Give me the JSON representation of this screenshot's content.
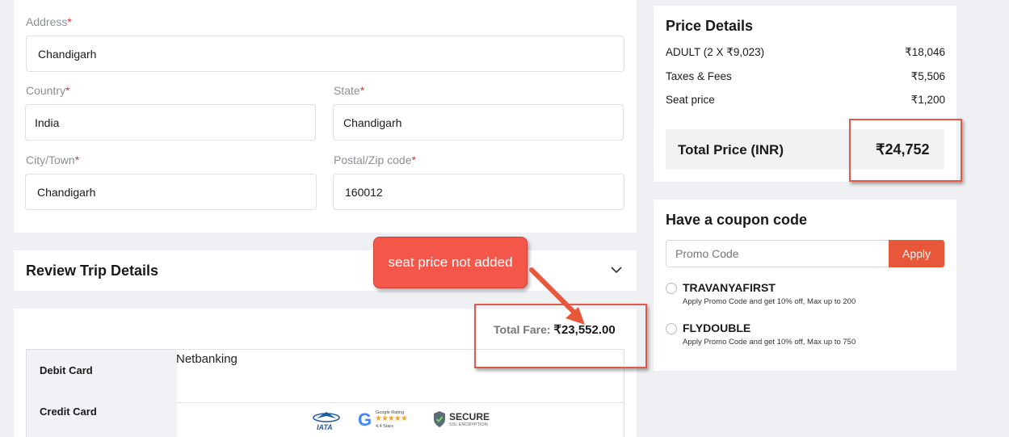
{
  "address_form": {
    "address": {
      "label": "Address",
      "value": "Chandigarh"
    },
    "country": {
      "label": "Country",
      "value": "India"
    },
    "state": {
      "label": "State",
      "value": "Chandigarh"
    },
    "city": {
      "label": "City/Town",
      "value": "Chandigarh"
    },
    "postal": {
      "label": "Postal/Zip code",
      "value": "160012"
    },
    "required_mark": "*"
  },
  "review": {
    "title": "Review Trip Details"
  },
  "annotation": {
    "text": "seat price not added"
  },
  "payment": {
    "total_fare_label": "Total Fare:",
    "total_fare_value": "₹23,552.00",
    "methods": [
      "Debit Card",
      "Credit Card"
    ],
    "selected_tab": "Netbanking",
    "badges": {
      "iata": "IATA",
      "google_rating": "Google Rating",
      "google_stars": "4.4 Stars",
      "secure": "SECURE",
      "secure_sub": "SSL ENCRYPTION"
    }
  },
  "price_details": {
    "title": "Price Details",
    "rows": [
      {
        "label": "ADULT (2 X ₹9,023)",
        "value": "₹18,046"
      },
      {
        "label": "Taxes & Fees",
        "value": "₹5,506"
      },
      {
        "label": "Seat price",
        "value": "₹1,200"
      }
    ],
    "total_label": "Total Price (INR)",
    "total_value": "₹24,752"
  },
  "coupon": {
    "title": "Have a coupon code",
    "placeholder": "Promo Code",
    "apply_label": "Apply",
    "items": [
      {
        "code": "TRAVANYAFIRST",
        "desc": "Apply Promo Code and get 10% off, Max up to 200"
      },
      {
        "code": "FLYDOUBLE",
        "desc": "Apply Promo Code and get 10% off, Max up to 750"
      }
    ]
  },
  "colors": {
    "accent": "#e8573a",
    "annotation": "#f4574a",
    "highlight_box": "#e05a4a"
  }
}
